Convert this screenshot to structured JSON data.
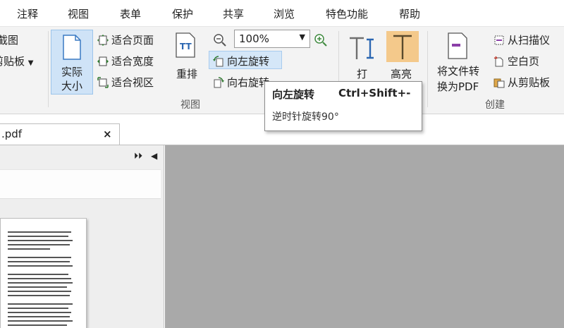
{
  "menu": {
    "tabs": [
      "注释",
      "视图",
      "表单",
      "保护",
      "共享",
      "浏览",
      "特色功能",
      "帮助"
    ]
  },
  "ribbon": {
    "left_partial": {
      "screenshot": "截图",
      "clipboard": "剪贴板"
    },
    "actual_size": {
      "line1": "实际",
      "line2": "大小"
    },
    "fit_page": "适合页面",
    "fit_width": "适合宽度",
    "fit_view": "适合视区",
    "reflow": "重排",
    "zoom_value": "100%",
    "rotate_left": "向左旋转",
    "rotate_right": "向右旋转",
    "view_group_label": "视图",
    "typewriter": "打",
    "highlight": "高亮",
    "convert": {
      "line1": "将文件转",
      "line2": "换为PDF"
    },
    "from_scanner": "从扫描仪",
    "blank_page": "空白页",
    "from_clipboard": "从剪贴板",
    "create_group_label": "创建"
  },
  "tooltip": {
    "title": "向左旋转",
    "shortcut": "Ctrl+Shift+-",
    "description": "逆时针旋转90°"
  },
  "document_tab": {
    "filename": ".pdf",
    "close": "×"
  },
  "panel": {
    "expand": "⏵⏵",
    "collapse": "◀"
  },
  "colors": {
    "ribbon_bg": "#f3f3f3",
    "selected_button": "#cfe3f7",
    "highlight_icon_bg": "#f4c98b",
    "canvas_bg": "#a9a9a9"
  }
}
